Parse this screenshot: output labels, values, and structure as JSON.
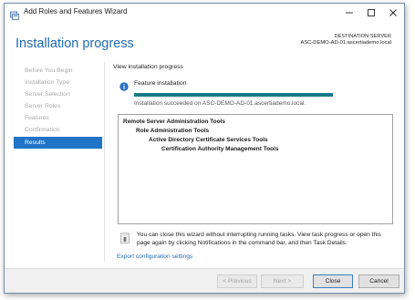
{
  "window": {
    "title": "Add Roles and Features Wizard",
    "controls": {
      "minimize": "—",
      "maximize": "☐",
      "close": "✕"
    }
  },
  "header": {
    "page_title": "Installation progress",
    "destination_label": "DESTINATION SERVER",
    "destination_server": "ASC-DEMO-AD-01.ascertiademo.local"
  },
  "sidebar": {
    "items": [
      {
        "label": "Before You Begin",
        "state": "disabled"
      },
      {
        "label": "Installation Type",
        "state": "disabled"
      },
      {
        "label": "Server Selection",
        "state": "disabled"
      },
      {
        "label": "Server Roles",
        "state": "disabled"
      },
      {
        "label": "Features",
        "state": "disabled"
      },
      {
        "label": "Confirmation",
        "state": "disabled"
      },
      {
        "label": "Results",
        "state": "active"
      }
    ]
  },
  "main": {
    "view_progress_label": "View installation progress",
    "feature_installation_label": "Feature installation",
    "progress_fraction": 1.0,
    "success_message": "Installation succeeded on ASC-DEMO-AD-01.ascertiademo.local.",
    "results": [
      {
        "text": "Remote Server Administration Tools",
        "level": 0
      },
      {
        "text": "Role Administration Tools",
        "level": 1
      },
      {
        "text": "Active Directory Certificate Services Tools",
        "level": 2
      },
      {
        "text": "Certification Authority Management Tools",
        "level": 3
      }
    ],
    "note": "You can close this wizard without interrupting running tasks. View task progress or open this page again by clicking Notifications in the command bar, and then Task Details.",
    "export_link": "Export configuration settings"
  },
  "footer": {
    "previous_label": "< Previous",
    "next_label": "Next >",
    "close_label": "Close",
    "cancel_label": "Cancel"
  },
  "colors": {
    "accent": "#1f74c7",
    "title_blue": "#1f6bb5",
    "progress": "#1b7a8a",
    "info_icon": "#2a6fc0"
  }
}
